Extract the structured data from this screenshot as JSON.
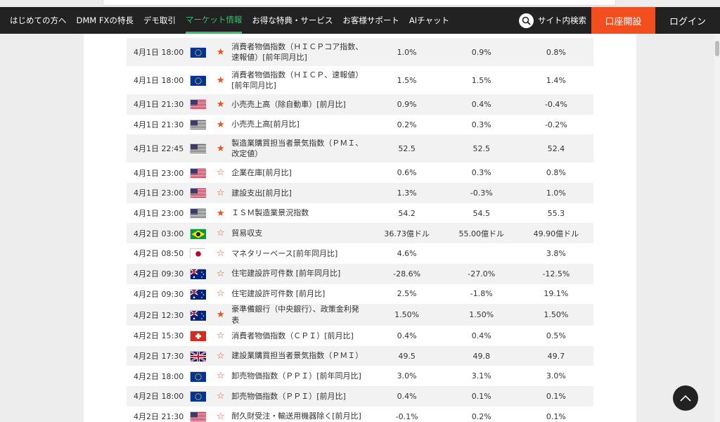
{
  "nav": {
    "items": [
      "はじめての方へ",
      "DMM FXの特長",
      "デモ取引",
      "マーケット情報",
      "お得な特典・サービス",
      "お客様サポート",
      "AIチャット"
    ],
    "active_index": 3,
    "search_label": "サイト内検索",
    "open_account_label": "口座開設",
    "login_label": "ログイン"
  },
  "colors": {
    "accent_green": "#33c06a",
    "accent_orange": "#f24e1e",
    "nav_bg": "#222222"
  },
  "rows": [
    {
      "time": "4月1日 18:00",
      "flag": "eu-flag-icon",
      "star": "filled",
      "indicator": "消費者物価指数（ＨＩＣＰコア指数、速報値）[前年同月比]",
      "v1": "1.0%",
      "v2": "0.9%",
      "v3": "0.8%",
      "tall": true
    },
    {
      "time": "4月1日 18:00",
      "flag": "eu-flag-icon",
      "star": "filled",
      "indicator": "消費者物価指数（ＨＩＣＰ、速報値）[前年同月比]",
      "v1": "1.5%",
      "v2": "1.5%",
      "v3": "1.4%",
      "tall": true
    },
    {
      "time": "4月1日 21:30",
      "flag": "us-flag-icon",
      "star": "filled",
      "indicator": "小売売上高（除自動車）[前月比]",
      "v1": "0.9%",
      "v2": "0.4%",
      "v3": "-0.4%"
    },
    {
      "time": "4月1日 21:30",
      "flag": "us-flag-icon",
      "star": "filled",
      "indicator": "小売売上高[前月比]",
      "v1": "0.2%",
      "v2": "0.3%",
      "v3": "-0.2%"
    },
    {
      "time": "4月1日 22:45",
      "flag": "us-flag-icon",
      "star": "filled",
      "indicator": "製造業購買担当者景気指数（ＰＭＩ、改定値）",
      "v1": "52.5",
      "v2": "52.5",
      "v3": "52.4",
      "tall": true
    },
    {
      "time": "4月1日 23:00",
      "flag": "us-flag-icon",
      "star": "empty",
      "indicator": "企業在庫[前月比]",
      "v1": "0.6%",
      "v2": "0.3%",
      "v3": "0.8%"
    },
    {
      "time": "4月1日 23:00",
      "flag": "us-flag-icon",
      "star": "empty",
      "indicator": "建設支出[前月比]",
      "v1": "1.3%",
      "v2": "-0.3%",
      "v3": "1.0%"
    },
    {
      "time": "4月1日 23:00",
      "flag": "us-flag-icon",
      "star": "filled",
      "indicator": "ＩＳＭ製造業景況指数",
      "v1": "54.2",
      "v2": "54.5",
      "v3": "55.3"
    },
    {
      "time": "4月2日 03:00",
      "flag": "br-flag-icon",
      "star": "empty",
      "indicator": "貿易収支",
      "v1": "36.73億ドル",
      "v2": "55.00億ドル",
      "v3": "49.90億ドル"
    },
    {
      "time": "4月2日 08:50",
      "flag": "jp-flag-icon",
      "star": "empty",
      "indicator": "マネタリーベース[前年同月比]",
      "v1": "4.6%",
      "v2": "",
      "v3": "3.8%"
    },
    {
      "time": "4月2日 09:30",
      "flag": "au-flag-icon",
      "star": "empty",
      "indicator": "住宅建設許可件数 [前年同月比]",
      "v1": "-28.6%",
      "v2": "-27.0%",
      "v3": "-12.5%"
    },
    {
      "time": "4月2日 09:30",
      "flag": "au-flag-icon",
      "star": "empty",
      "indicator": "住宅建設許可件数 [前月比]",
      "v1": "2.5%",
      "v2": "-1.8%",
      "v3": "19.1%"
    },
    {
      "time": "4月2日 12:30",
      "flag": "au-flag-icon",
      "star": "filled",
      "indicator": "豪準備銀行（中央銀行）、政策金利発表",
      "v1": "1.50%",
      "v2": "1.50%",
      "v3": "1.50%"
    },
    {
      "time": "4月2日 15:30",
      "flag": "ch-flag-icon",
      "star": "empty",
      "indicator": "消費者物価指数（ＣＰＩ）[前月比]",
      "v1": "0.4%",
      "v2": "0.4%",
      "v3": "0.5%"
    },
    {
      "time": "4月2日 17:30",
      "flag": "uk-flag-icon",
      "star": "empty",
      "indicator": "建設業購買担当者景気指数（ＰＭＩ）",
      "v1": "49.5",
      "v2": "49.8",
      "v3": "49.7"
    },
    {
      "time": "4月2日 18:00",
      "flag": "eu-flag-icon",
      "star": "empty",
      "indicator": "卸売物価指数（ＰＰＩ）[前年同月比]",
      "v1": "3.0%",
      "v2": "3.1%",
      "v3": "3.0%"
    },
    {
      "time": "4月2日 18:00",
      "flag": "eu-flag-icon",
      "star": "empty",
      "indicator": "卸売物価指数（ＰＰＩ）[前月比]",
      "v1": "0.4%",
      "v2": "0.1%",
      "v3": "0.1%"
    },
    {
      "time": "4月2日 21:30",
      "flag": "us-flag-icon",
      "star": "empty",
      "indicator": "耐久財受注・輸送用機器除く[前月比]",
      "v1": "-0.1%",
      "v2": "0.2%",
      "v3": "0.1%"
    }
  ]
}
